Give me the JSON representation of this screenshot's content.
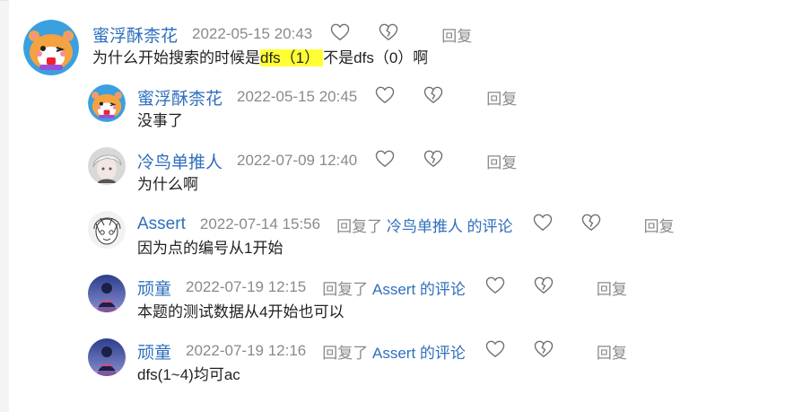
{
  "comments": [
    {
      "author": "蜜浮酥柰花",
      "time": "2022-05-15 20:43",
      "reply_to": null,
      "body_parts": [
        {
          "text": "为什么开始搜索的时候是",
          "hl": false
        },
        {
          "text": "dfs（1）",
          "hl": true
        },
        {
          "text": "不是dfs（0）啊",
          "hl": false
        }
      ],
      "reply_label": "回复",
      "avatar": "hamster-avatar"
    },
    {
      "author": "蜜浮酥柰花",
      "time": "2022-05-15 20:45",
      "reply_to": null,
      "body_parts": [
        {
          "text": "没事了",
          "hl": false
        }
      ],
      "reply_label": "回复",
      "avatar": "hamster-avatar"
    },
    {
      "author": "冷鸟单推人",
      "time": "2022-07-09 12:40",
      "reply_to": null,
      "body_parts": [
        {
          "text": "为什么啊",
          "hl": false
        }
      ],
      "reply_label": "回复",
      "avatar": "anime-boy-avatar"
    },
    {
      "author": "Assert",
      "time": "2022-07-14 15:56",
      "reply_to": {
        "prefix": "回复了 ",
        "target": "冷鸟单推人",
        "suffix": " 的评论"
      },
      "body_parts": [
        {
          "text": "因为点的编号从1开始",
          "hl": false
        }
      ],
      "reply_label": "回复",
      "avatar": "sketch-avatar"
    },
    {
      "author": "顽童",
      "time": "2022-07-19 12:15",
      "reply_to": {
        "prefix": "回复了 ",
        "target": "Assert",
        "suffix": " 的评论"
      },
      "body_parts": [
        {
          "text": "本题的测试数据从4开始也可以",
          "hl": false
        }
      ],
      "reply_label": "回复",
      "avatar": "night-figure-avatar"
    },
    {
      "author": "顽童",
      "time": "2022-07-19 12:16",
      "reply_to": {
        "prefix": "回复了 ",
        "target": "Assert",
        "suffix": " 的评论"
      },
      "body_parts": [
        {
          "text": "dfs(1~4)均可ac",
          "hl": false
        }
      ],
      "reply_label": "回复",
      "avatar": "night-figure-avatar"
    }
  ],
  "colors": {
    "author_link": "#2f6fbd",
    "meta_gray": "#8a8a8a",
    "highlight": "#ffff33",
    "icon_stroke": "#6f6f6f"
  },
  "icons": {
    "like": "heart-outline-icon",
    "dislike": "broken-heart-icon"
  }
}
